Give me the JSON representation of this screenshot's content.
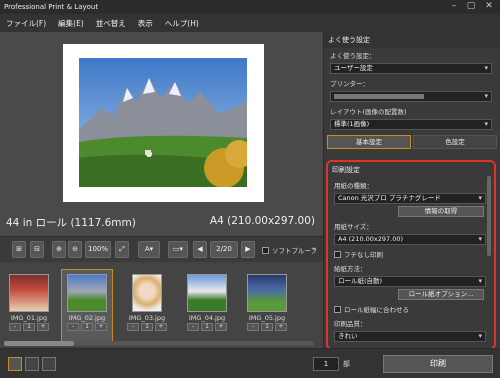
{
  "window": {
    "title": "Professional Print & Layout"
  },
  "menu": [
    "ファイル(F)",
    "編集(E)",
    "並べ替え",
    "表示",
    "ヘルプ(H)"
  ],
  "preview": {
    "roll_label": "44 in ロール (1117.6mm)",
    "size_label": "A4 (210.00x297.00)"
  },
  "toolbar": {
    "zoom": "100%",
    "page": "2/20",
    "softproof": "ソフトプルーフ"
  },
  "thumbs": [
    {
      "name": "IMG_01.jpg",
      "qty": "1"
    },
    {
      "name": "IMG_02.jpg",
      "qty": "1"
    },
    {
      "name": "IMG_03.jpg",
      "qty": "1"
    },
    {
      "name": "IMG_04.jpg",
      "qty": "1"
    },
    {
      "name": "IMG_05.jpg",
      "qty": "1"
    }
  ],
  "panel": {
    "favorites_header": "よく使う設定",
    "favorites_label": "よく使う設定：",
    "favorites_value": "ユーザー設定",
    "printer_label": "プリンター：",
    "layout_label": "レイアウト(画像の配置数)",
    "layout_value": "標準(1画像)",
    "tab_basic": "基本設定",
    "tab_color": "色設定",
    "print_settings": "印刷設定",
    "media_label": "用紙の種類：",
    "media_value": "Canon 光沢プロ プラチナグレード",
    "info_button": "情報の取得",
    "paper_size_label": "用紙サイズ：",
    "paper_size_value": "A4 (210.00x297.00)",
    "borderless": "フチなし印刷",
    "feed_label": "給紙方法：",
    "feed_value": "ロール紙(自動)",
    "roll_options": "ロール紙オプション...",
    "fit_roll": "ロール紙幅に合わせる",
    "quality_label": "印刷品質：",
    "quality_value": "きれい"
  },
  "bottom": {
    "copies": "1",
    "copies_unit": "部",
    "print_button": "印刷"
  }
}
